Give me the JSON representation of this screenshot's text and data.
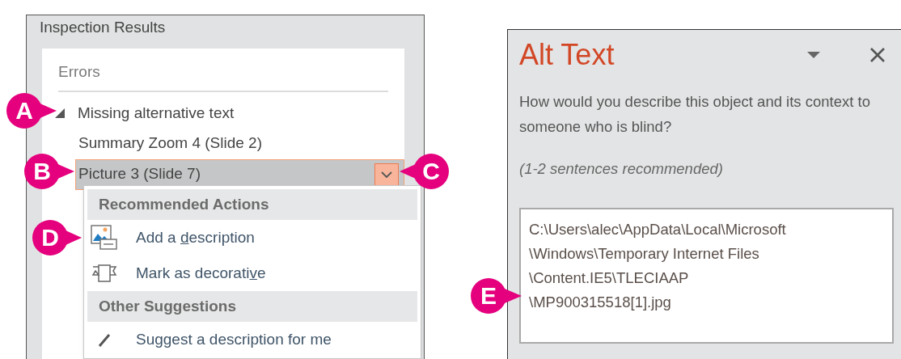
{
  "inspection_panel": {
    "title": "Inspection Results",
    "section": "Errors",
    "groups": [
      {
        "label": "Missing alternative text",
        "expanded": true,
        "children": [
          {
            "label": "Summary Zoom 4  (Slide 2)",
            "selected": false
          },
          {
            "label": "Picture 3  (Slide 7)",
            "selected": true
          }
        ]
      }
    ]
  },
  "context_menu": {
    "sections": [
      {
        "heading": "Recommended Actions",
        "items": [
          {
            "kind": "add_description",
            "label_parts": [
              "Add a ",
              "d",
              "escription"
            ]
          },
          {
            "kind": "mark_decorative",
            "label_parts": [
              "Mark as decorati",
              "v",
              "e"
            ]
          }
        ]
      },
      {
        "heading": "Other Suggestions",
        "items": [
          {
            "kind": "suggest",
            "label_parts": [
              "Suggest a description for me"
            ]
          }
        ]
      }
    ]
  },
  "alt_text_pane": {
    "title": "Alt Text",
    "prompt": "How would you describe this object and its context to someone who is blind?",
    "note": "(1-2 sentences recommended)",
    "value": "C:\\Users\\alec\\AppData\\Local\\Microsoft\n\\Windows\\Temporary Internet Files\n\\Content.IE5\\TLECIAAP\n\\MP900315518[1].jpg"
  },
  "callouts": [
    {
      "label": "A"
    },
    {
      "label": "B"
    },
    {
      "label": "C"
    },
    {
      "label": "D"
    },
    {
      "label": "E"
    }
  ]
}
